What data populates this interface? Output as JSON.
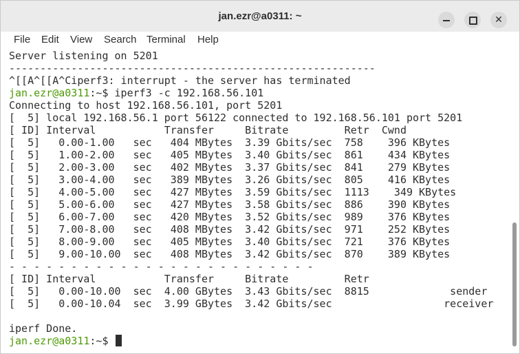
{
  "window": {
    "title": "jan.ezr@a0311: ~"
  },
  "menu": [
    "File",
    "Edit",
    "View",
    "Search",
    "Terminal",
    "Help"
  ],
  "prompt": {
    "user_host": "jan.ezr@a0311",
    "path": ":~$ "
  },
  "terminal": {
    "line_0": "Server listening on 5201",
    "line_1": "-----------------------------------------------------------",
    "line_2": "^[[A^[[A^Ciperf3: interrupt - the server has terminated",
    "line_3_cmd": "iperf3 -c 192.168.56.101",
    "line_4": "Connecting to host 192.168.56.101, port 5201",
    "line_5": "[  5] local 192.168.56.1 port 56122 connected to 192.168.56.101 port 5201",
    "line_6": "[ ID] Interval           Transfer     Bitrate         Retr  Cwnd",
    "line_7": "[  5]   0.00-1.00   sec   404 MBytes  3.39 Gbits/sec  758    396 KBytes",
    "line_8": "[  5]   1.00-2.00   sec   405 MBytes  3.40 Gbits/sec  861    434 KBytes",
    "line_9": "[  5]   2.00-3.00   sec   402 MBytes  3.37 Gbits/sec  841    279 KBytes",
    "line_10": "[  5]   3.00-4.00   sec   389 MBytes  3.26 Gbits/sec  805    416 KBytes",
    "line_11": "[  5]   4.00-5.00   sec   427 MBytes  3.59 Gbits/sec  1113    349 KBytes",
    "line_12": "[  5]   5.00-6.00   sec   427 MBytes  3.58 Gbits/sec  886    390 KBytes",
    "line_13": "[  5]   6.00-7.00   sec   420 MBytes  3.52 Gbits/sec  989    376 KBytes",
    "line_14": "[  5]   7.00-8.00   sec   408 MBytes  3.42 Gbits/sec  971    252 KBytes",
    "line_15": "[  5]   8.00-9.00   sec   405 MBytes  3.40 Gbits/sec  721    376 KBytes",
    "line_16": "[  5]   9.00-10.00  sec   408 MBytes  3.42 Gbits/sec  870    389 KBytes",
    "line_17": "- - - - - - - - - - - - - - - - - - - - - - - - -",
    "line_18": "[ ID] Interval           Transfer     Bitrate         Retr",
    "line_19": "[  5]   0.00-10.00  sec  4.00 GBytes  3.43 Gbits/sec  8815             sender",
    "line_20": "[  5]   0.00-10.04  sec  3.99 GBytes  3.42 Gbits/sec                  receiver",
    "line_21": "",
    "line_22": "iperf Done."
  }
}
